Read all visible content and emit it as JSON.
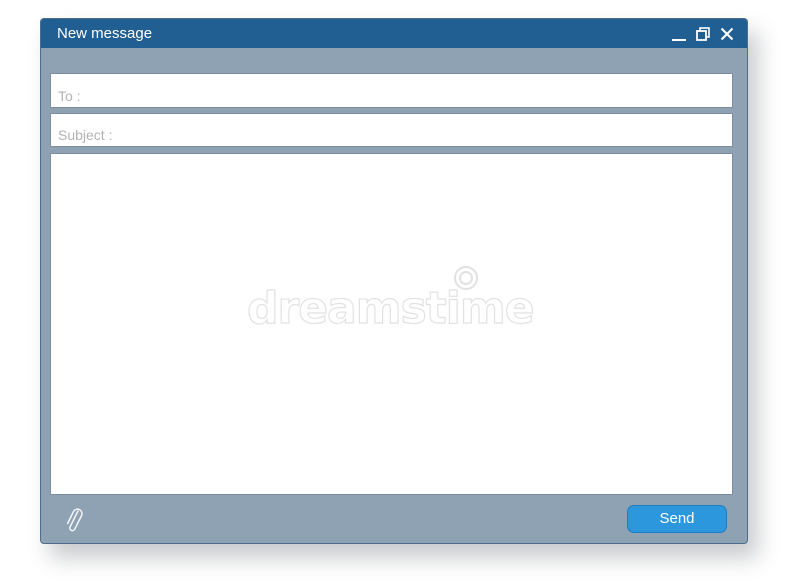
{
  "window": {
    "title": "New message"
  },
  "title_controls": {
    "minimize_icon": "minimize-icon",
    "restore_icon": "restore-icon",
    "close_icon": "close-icon"
  },
  "fields": {
    "to_placeholder": "To :",
    "to_value": "",
    "subject_placeholder": "Subject :",
    "subject_value": "",
    "body_value": ""
  },
  "watermark": {
    "text": "dreamstime"
  },
  "footer": {
    "attach_icon": "paperclip-icon",
    "send_label": "Send"
  },
  "colors": {
    "titlebar": "#215f93",
    "window_bg": "#8fa2b3",
    "send_button": "#2c97dc"
  }
}
